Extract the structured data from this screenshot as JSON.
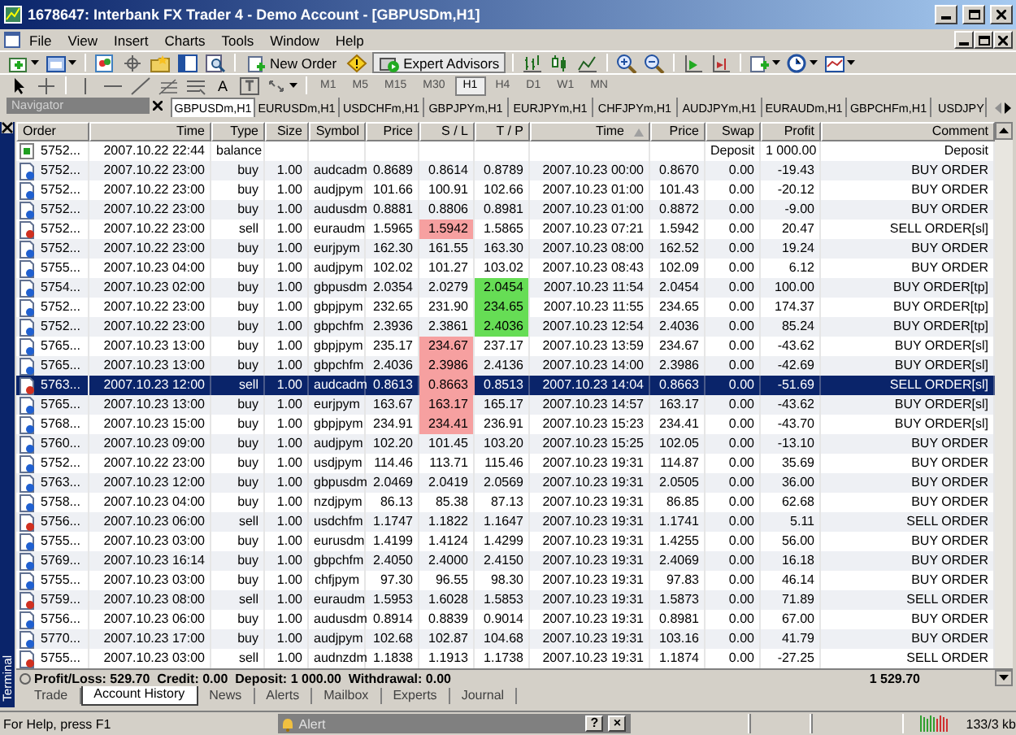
{
  "window": {
    "title": "1678647: Interbank FX Trader 4 - Demo Account - [GBPUSDm,H1]"
  },
  "menu": [
    "File",
    "View",
    "Insert",
    "Charts",
    "Tools",
    "Window",
    "Help"
  ],
  "toolbar": {
    "new_order": "New Order",
    "expert_advisors": "Expert Advisors",
    "text_tool": "A"
  },
  "timeframes": [
    {
      "label": "M1",
      "selected": false
    },
    {
      "label": "M5",
      "selected": false
    },
    {
      "label": "M15",
      "selected": false
    },
    {
      "label": "M30",
      "selected": false
    },
    {
      "label": "H1",
      "selected": true
    },
    {
      "label": "H4",
      "selected": false
    },
    {
      "label": "D1",
      "selected": false
    },
    {
      "label": "W1",
      "selected": false
    },
    {
      "label": "MN",
      "selected": false
    }
  ],
  "navigator": {
    "title": "Navigator"
  },
  "chart_tabs": [
    {
      "label": "GBPUSDm,H1",
      "selected": true
    },
    {
      "label": "EURUSDm,H1",
      "selected": false
    },
    {
      "label": "USDCHFm,H1",
      "selected": false
    },
    {
      "label": "GBPJPYm,H1",
      "selected": false
    },
    {
      "label": "EURJPYm,H1",
      "selected": false
    },
    {
      "label": "CHFJPYm,H1",
      "selected": false
    },
    {
      "label": "AUDJPYm,H1",
      "selected": false
    },
    {
      "label": "EURAUDm,H1",
      "selected": false
    },
    {
      "label": "GBPCHFm,H1",
      "selected": false
    },
    {
      "label": "USDJPY",
      "selected": false
    }
  ],
  "terminal": {
    "title": "Terminal"
  },
  "table": {
    "columns": [
      "Order",
      "Time",
      "Type",
      "Size",
      "Symbol",
      "Price",
      "S / L",
      "T / P",
      "Time",
      "Price",
      "Swap",
      "Profit",
      "Comment"
    ],
    "rows": [
      {
        "kind": "balance",
        "cells": [
          "5752...",
          "2007.10.22 22:44",
          "balance",
          "",
          "",
          "",
          "",
          "",
          "",
          "",
          "Deposit",
          "1 000.00",
          "Deposit"
        ],
        "sl_hit": false,
        "tp_hit": false,
        "selected": false
      },
      {
        "kind": "buy",
        "cells": [
          "5752...",
          "2007.10.22 23:00",
          "buy",
          "1.00",
          "audcadm",
          "0.8689",
          "0.8614",
          "0.8789",
          "2007.10.23 00:00",
          "0.8670",
          "0.00",
          "-19.43",
          "BUY ORDER"
        ],
        "sl_hit": false,
        "tp_hit": false,
        "selected": false
      },
      {
        "kind": "buy",
        "cells": [
          "5752...",
          "2007.10.22 23:00",
          "buy",
          "1.00",
          "audjpym",
          "101.66",
          "100.91",
          "102.66",
          "2007.10.23 01:00",
          "101.43",
          "0.00",
          "-20.12",
          "BUY ORDER"
        ],
        "sl_hit": false,
        "tp_hit": false,
        "selected": false
      },
      {
        "kind": "buy",
        "cells": [
          "5752...",
          "2007.10.22 23:00",
          "buy",
          "1.00",
          "audusdm",
          "0.8881",
          "0.8806",
          "0.8981",
          "2007.10.23 01:00",
          "0.8872",
          "0.00",
          "-9.00",
          "BUY ORDER"
        ],
        "sl_hit": false,
        "tp_hit": false,
        "selected": false
      },
      {
        "kind": "sell",
        "cells": [
          "5752...",
          "2007.10.22 23:00",
          "sell",
          "1.00",
          "euraudm",
          "1.5965",
          "1.5942",
          "1.5865",
          "2007.10.23 07:21",
          "1.5942",
          "0.00",
          "20.47",
          "SELL ORDER[sl]"
        ],
        "sl_hit": true,
        "tp_hit": false,
        "selected": false
      },
      {
        "kind": "buy",
        "cells": [
          "5752...",
          "2007.10.22 23:00",
          "buy",
          "1.00",
          "eurjpym",
          "162.30",
          "161.55",
          "163.30",
          "2007.10.23 08:00",
          "162.52",
          "0.00",
          "19.24",
          "BUY ORDER"
        ],
        "sl_hit": false,
        "tp_hit": false,
        "selected": false
      },
      {
        "kind": "buy",
        "cells": [
          "5755...",
          "2007.10.23 04:00",
          "buy",
          "1.00",
          "audjpym",
          "102.02",
          "101.27",
          "103.02",
          "2007.10.23 08:43",
          "102.09",
          "0.00",
          "6.12",
          "BUY ORDER"
        ],
        "sl_hit": false,
        "tp_hit": false,
        "selected": false
      },
      {
        "kind": "buy",
        "cells": [
          "5754...",
          "2007.10.23 02:00",
          "buy",
          "1.00",
          "gbpusdm",
          "2.0354",
          "2.0279",
          "2.0454",
          "2007.10.23 11:54",
          "2.0454",
          "0.00",
          "100.00",
          "BUY ORDER[tp]"
        ],
        "sl_hit": false,
        "tp_hit": true,
        "selected": false
      },
      {
        "kind": "buy",
        "cells": [
          "5752...",
          "2007.10.22 23:00",
          "buy",
          "1.00",
          "gbpjpym",
          "232.65",
          "231.90",
          "234.65",
          "2007.10.23 11:55",
          "234.65",
          "0.00",
          "174.37",
          "BUY ORDER[tp]"
        ],
        "sl_hit": false,
        "tp_hit": true,
        "selected": false
      },
      {
        "kind": "buy",
        "cells": [
          "5752...",
          "2007.10.22 23:00",
          "buy",
          "1.00",
          "gbpchfm",
          "2.3936",
          "2.3861",
          "2.4036",
          "2007.10.23 12:54",
          "2.4036",
          "0.00",
          "85.24",
          "BUY ORDER[tp]"
        ],
        "sl_hit": false,
        "tp_hit": true,
        "selected": false
      },
      {
        "kind": "buy",
        "cells": [
          "5765...",
          "2007.10.23 13:00",
          "buy",
          "1.00",
          "gbpjpym",
          "235.17",
          "234.67",
          "237.17",
          "2007.10.23 13:59",
          "234.67",
          "0.00",
          "-43.62",
          "BUY ORDER[sl]"
        ],
        "sl_hit": true,
        "tp_hit": false,
        "selected": false
      },
      {
        "kind": "buy",
        "cells": [
          "5765...",
          "2007.10.23 13:00",
          "buy",
          "1.00",
          "gbpchfm",
          "2.4036",
          "2.3986",
          "2.4136",
          "2007.10.23 14:00",
          "2.3986",
          "0.00",
          "-42.69",
          "BUY ORDER[sl]"
        ],
        "sl_hit": true,
        "tp_hit": false,
        "selected": false
      },
      {
        "kind": "sell",
        "cells": [
          "5763...",
          "2007.10.23 12:00",
          "sell",
          "1.00",
          "audcadm",
          "0.8613",
          "0.8663",
          "0.8513",
          "2007.10.23 14:04",
          "0.8663",
          "0.00",
          "-51.69",
          "SELL ORDER[sl]"
        ],
        "sl_hit": true,
        "tp_hit": false,
        "selected": true
      },
      {
        "kind": "buy",
        "cells": [
          "5765...",
          "2007.10.23 13:00",
          "buy",
          "1.00",
          "eurjpym",
          "163.67",
          "163.17",
          "165.17",
          "2007.10.23 14:57",
          "163.17",
          "0.00",
          "-43.62",
          "BUY ORDER[sl]"
        ],
        "sl_hit": true,
        "tp_hit": false,
        "selected": false
      },
      {
        "kind": "buy",
        "cells": [
          "5768...",
          "2007.10.23 15:00",
          "buy",
          "1.00",
          "gbpjpym",
          "234.91",
          "234.41",
          "236.91",
          "2007.10.23 15:23",
          "234.41",
          "0.00",
          "-43.70",
          "BUY ORDER[sl]"
        ],
        "sl_hit": true,
        "tp_hit": false,
        "selected": false
      },
      {
        "kind": "buy",
        "cells": [
          "5760...",
          "2007.10.23 09:00",
          "buy",
          "1.00",
          "audjpym",
          "102.20",
          "101.45",
          "103.20",
          "2007.10.23 15:25",
          "102.05",
          "0.00",
          "-13.10",
          "BUY ORDER"
        ],
        "sl_hit": false,
        "tp_hit": false,
        "selected": false
      },
      {
        "kind": "buy",
        "cells": [
          "5752...",
          "2007.10.22 23:00",
          "buy",
          "1.00",
          "usdjpym",
          "114.46",
          "113.71",
          "115.46",
          "2007.10.23 19:31",
          "114.87",
          "0.00",
          "35.69",
          "BUY ORDER"
        ],
        "sl_hit": false,
        "tp_hit": false,
        "selected": false
      },
      {
        "kind": "buy",
        "cells": [
          "5763...",
          "2007.10.23 12:00",
          "buy",
          "1.00",
          "gbpusdm",
          "2.0469",
          "2.0419",
          "2.0569",
          "2007.10.23 19:31",
          "2.0505",
          "0.00",
          "36.00",
          "BUY ORDER"
        ],
        "sl_hit": false,
        "tp_hit": false,
        "selected": false
      },
      {
        "kind": "buy",
        "cells": [
          "5758...",
          "2007.10.23 04:00",
          "buy",
          "1.00",
          "nzdjpym",
          "86.13",
          "85.38",
          "87.13",
          "2007.10.23 19:31",
          "86.85",
          "0.00",
          "62.68",
          "BUY ORDER"
        ],
        "sl_hit": false,
        "tp_hit": false,
        "selected": false
      },
      {
        "kind": "sell",
        "cells": [
          "5756...",
          "2007.10.23 06:00",
          "sell",
          "1.00",
          "usdchfm",
          "1.1747",
          "1.1822",
          "1.1647",
          "2007.10.23 19:31",
          "1.1741",
          "0.00",
          "5.11",
          "SELL ORDER"
        ],
        "sl_hit": false,
        "tp_hit": false,
        "selected": false
      },
      {
        "kind": "buy",
        "cells": [
          "5755...",
          "2007.10.23 03:00",
          "buy",
          "1.00",
          "eurusdm",
          "1.4199",
          "1.4124",
          "1.4299",
          "2007.10.23 19:31",
          "1.4255",
          "0.00",
          "56.00",
          "BUY ORDER"
        ],
        "sl_hit": false,
        "tp_hit": false,
        "selected": false
      },
      {
        "kind": "buy",
        "cells": [
          "5769...",
          "2007.10.23 16:14",
          "buy",
          "1.00",
          "gbpchfm",
          "2.4050",
          "2.4000",
          "2.4150",
          "2007.10.23 19:31",
          "2.4069",
          "0.00",
          "16.18",
          "BUY ORDER"
        ],
        "sl_hit": false,
        "tp_hit": false,
        "selected": false
      },
      {
        "kind": "buy",
        "cells": [
          "5755...",
          "2007.10.23 03:00",
          "buy",
          "1.00",
          "chfjpym",
          "97.30",
          "96.55",
          "98.30",
          "2007.10.23 19:31",
          "97.83",
          "0.00",
          "46.14",
          "BUY ORDER"
        ],
        "sl_hit": false,
        "tp_hit": false,
        "selected": false
      },
      {
        "kind": "sell",
        "cells": [
          "5759...",
          "2007.10.23 08:00",
          "sell",
          "1.00",
          "euraudm",
          "1.5953",
          "1.6028",
          "1.5853",
          "2007.10.23 19:31",
          "1.5873",
          "0.00",
          "71.89",
          "SELL ORDER"
        ],
        "sl_hit": false,
        "tp_hit": false,
        "selected": false
      },
      {
        "kind": "buy",
        "cells": [
          "5756...",
          "2007.10.23 06:00",
          "buy",
          "1.00",
          "audusdm",
          "0.8914",
          "0.8839",
          "0.9014",
          "2007.10.23 19:31",
          "0.8981",
          "0.00",
          "67.00",
          "BUY ORDER"
        ],
        "sl_hit": false,
        "tp_hit": false,
        "selected": false
      },
      {
        "kind": "buy",
        "cells": [
          "5770...",
          "2007.10.23 17:00",
          "buy",
          "1.00",
          "audjpym",
          "102.68",
          "102.87",
          "104.68",
          "2007.10.23 19:31",
          "103.16",
          "0.00",
          "41.79",
          "BUY ORDER"
        ],
        "sl_hit": false,
        "tp_hit": false,
        "selected": false
      },
      {
        "kind": "sell",
        "cells": [
          "5755...",
          "2007.10.23 03:00",
          "sell",
          "1.00",
          "audnzdm",
          "1.1838",
          "1.1913",
          "1.1738",
          "2007.10.23 19:31",
          "1.1874",
          "0.00",
          "-27.25",
          "SELL ORDER"
        ],
        "sl_hit": false,
        "tp_hit": false,
        "selected": false
      }
    ],
    "summary": {
      "text": "Profit/Loss: 529.70  Credit: 0.00  Deposit: 1 000.00  Withdrawal: 0.00",
      "total": "1 529.70"
    }
  },
  "terminal_tabs": [
    {
      "label": "Trade",
      "selected": false
    },
    {
      "label": "Account History",
      "selected": true
    },
    {
      "label": "News",
      "selected": false
    },
    {
      "label": "Alerts",
      "selected": false
    },
    {
      "label": "Mailbox",
      "selected": false
    },
    {
      "label": "Experts",
      "selected": false
    },
    {
      "label": "Journal",
      "selected": false
    }
  ],
  "status_bar": {
    "help": "For Help, press F1",
    "alert_title": "Alert",
    "alert_help": "?",
    "alert_close": "×",
    "traffic": "133/3 kb"
  }
}
